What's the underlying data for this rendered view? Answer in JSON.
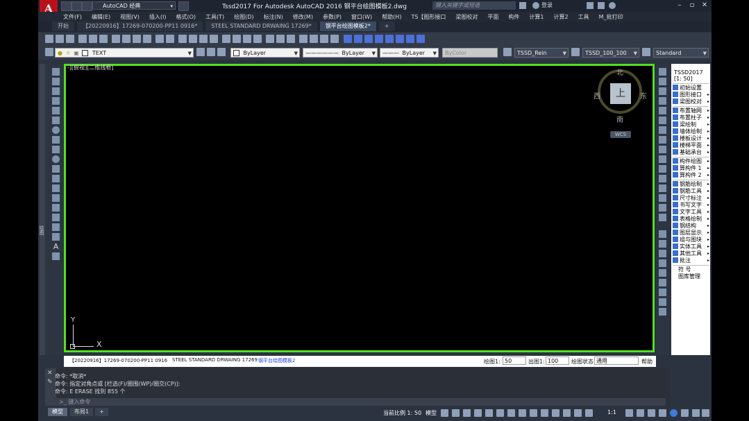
{
  "titlebar": {
    "workspace": "AutoCAD 经典",
    "app_title": "Tssd2017 For Autodesk AutoCAD 2016    钢平台绘图模板2.dwg",
    "search_placeholder": "键入关键字或短语",
    "login": "登录"
  },
  "menubar": [
    "文件(F)",
    "编辑(E)",
    "视图(V)",
    "插入(I)",
    "格式(O)",
    "工具(T)",
    "绘图(D)",
    "标注(N)",
    "修改(M)",
    "参数(P)",
    "窗口(W)",
    "帮助(H)",
    "TS【图形接口",
    "梁图校对",
    "平面",
    "构件",
    "计算1",
    "计算2",
    "工具",
    "M_批打印"
  ],
  "file_tabs": [
    {
      "label": "开始",
      "active": false
    },
    {
      "label": "【20220916】17269-070200-PP11 0916*",
      "active": false
    },
    {
      "label": "STEEL STANDARD DRWAING 17269*",
      "active": false
    },
    {
      "label": "钢平台绘图模板2*",
      "active": true
    }
  ],
  "toolbar2": {
    "layer": "TEXT",
    "color": "ByLayer",
    "linetype": "ByLayer",
    "lineweight": "ByLayer",
    "plotstyle": "ByColor",
    "text_style": "TSSD_Rein",
    "dim_style": "TSSD_100_100",
    "table_style": "Standard"
  },
  "left_toolbar_label": "绘图",
  "viewport_label": "-][俯视][二维线框]",
  "ucs": {
    "x": "X",
    "y": "Y"
  },
  "viewcube": {
    "north": "北",
    "south": "南",
    "east": "东",
    "west": "西",
    "top": "上",
    "wcs": "WCS"
  },
  "tssd_panel": {
    "title": "TSSD2017",
    "scale": "[1: 50]",
    "items": [
      {
        "label": "初始设置",
        "arrow": false
      },
      {
        "label": "图形接口",
        "arrow": true
      },
      {
        "label": "梁图校对",
        "arrow": true
      },
      {
        "label": "布置轴网",
        "arrow": true
      },
      {
        "label": "布置柱子",
        "arrow": true
      },
      {
        "label": "梁绘制",
        "arrow": true
      },
      {
        "label": "墙体绘制",
        "arrow": true
      },
      {
        "label": "楼板设计",
        "arrow": true
      },
      {
        "label": "楼梯平面",
        "arrow": true
      },
      {
        "label": "基础承台",
        "arrow": true
      },
      {
        "label": "构件绘图",
        "arrow": true
      },
      {
        "label": "算构件 1",
        "arrow": true
      },
      {
        "label": "算构件 2",
        "arrow": true
      },
      {
        "label": "钢筋绘制",
        "arrow": true
      },
      {
        "label": "钢筋工具",
        "arrow": true
      },
      {
        "label": "尺寸标注",
        "arrow": true
      },
      {
        "label": "书写文字",
        "arrow": true
      },
      {
        "label": "文字工具",
        "arrow": true
      },
      {
        "label": "表格绘制",
        "arrow": true
      },
      {
        "label": "钢结构",
        "arrow": true
      },
      {
        "label": "图层显示",
        "arrow": true
      },
      {
        "label": "组与图块",
        "arrow": true
      },
      {
        "label": "实体工具",
        "arrow": true
      },
      {
        "label": "其他工具",
        "arrow": true
      },
      {
        "label": "批注",
        "arrow": true
      },
      {
        "label": "符 号",
        "arrow": false
      },
      {
        "label": "图库管理",
        "arrow": false
      }
    ]
  },
  "layout_strip": {
    "tabs": [
      {
        "label": "【20220916】17269-070200-PP11 0916",
        "active": false
      },
      {
        "label": "STEEL STANDARD DRWAING 17269",
        "active": false
      },
      {
        "label": "钢平台绘图模板2",
        "active": true
      }
    ],
    "draw_scale_label": "绘图1:",
    "draw_scale_value": "50",
    "out_scale_label": "出图1:",
    "out_scale_value": "100",
    "draw_state_label": "绘图状态",
    "draw_state_value": "通用",
    "help": "帮助"
  },
  "command": {
    "lines": [
      "命令: *取消*",
      "命令: 指定对角点或 [栏选(F)/圈围(WP)/圈交(CP)]:",
      "命令: E ERASE 找到 855 个"
    ],
    "input_placeholder": "键入命令"
  },
  "statusbar": {
    "tabs": [
      {
        "label": "模型",
        "active": true
      },
      {
        "label": "布局1",
        "active": false
      }
    ],
    "current_scale": "当前比例 1: 50",
    "model_label": "模型",
    "annotation_scale": "1:1"
  }
}
